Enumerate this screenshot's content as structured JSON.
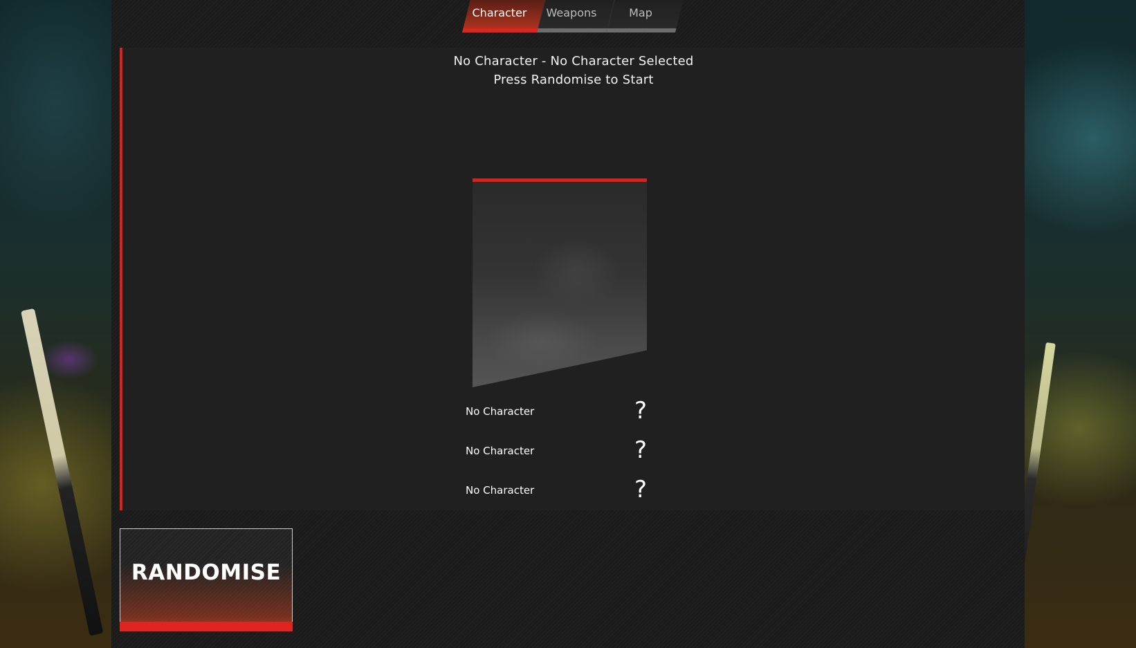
{
  "tabs": [
    {
      "label": "Character",
      "active": true
    },
    {
      "label": "Weapons",
      "active": false
    },
    {
      "label": "Map",
      "active": false
    }
  ],
  "character_panel": {
    "title": "No Character - No Character Selected",
    "subtitle": "Press Randomise to Start",
    "slots": [
      {
        "name": "No Character",
        "icon": "?"
      },
      {
        "name": "No Character",
        "icon": "?"
      },
      {
        "name": "No Character",
        "icon": "?"
      }
    ]
  },
  "actions": {
    "randomise_label": "RANDOMISE"
  },
  "colors": {
    "accent": "#d9221e",
    "panel": "#202020",
    "background": "#1b1b1b"
  }
}
